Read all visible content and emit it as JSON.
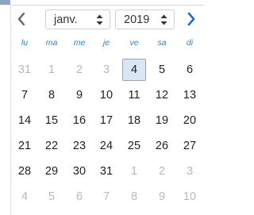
{
  "datepicker": {
    "month_value": "janv.",
    "year_value": "2019",
    "prev_icon": "chevron-left-icon",
    "next_icon": "chevron-right-icon",
    "select_arrows_icon": "updown-arrows-icon",
    "weekdays": [
      "lu",
      "ma",
      "me",
      "je",
      "ve",
      "sa",
      "di"
    ],
    "weeks": [
      [
        {
          "label": "31",
          "in_month": false
        },
        {
          "label": "1",
          "in_month": false
        },
        {
          "label": "2",
          "in_month": false
        },
        {
          "label": "3",
          "in_month": false
        },
        {
          "label": "4",
          "in_month": true,
          "selected": true
        },
        {
          "label": "5",
          "in_month": true
        },
        {
          "label": "6",
          "in_month": true
        }
      ],
      [
        {
          "label": "7",
          "in_month": true
        },
        {
          "label": "8",
          "in_month": true
        },
        {
          "label": "9",
          "in_month": true
        },
        {
          "label": "10",
          "in_month": true
        },
        {
          "label": "11",
          "in_month": true
        },
        {
          "label": "12",
          "in_month": true
        },
        {
          "label": "13",
          "in_month": true
        }
      ],
      [
        {
          "label": "14",
          "in_month": true
        },
        {
          "label": "15",
          "in_month": true
        },
        {
          "label": "16",
          "in_month": true
        },
        {
          "label": "17",
          "in_month": true
        },
        {
          "label": "18",
          "in_month": true
        },
        {
          "label": "19",
          "in_month": true
        },
        {
          "label": "20",
          "in_month": true
        }
      ],
      [
        {
          "label": "21",
          "in_month": true
        },
        {
          "label": "22",
          "in_month": true
        },
        {
          "label": "23",
          "in_month": true
        },
        {
          "label": "24",
          "in_month": true
        },
        {
          "label": "25",
          "in_month": true
        },
        {
          "label": "26",
          "in_month": true
        },
        {
          "label": "27",
          "in_month": true
        }
      ],
      [
        {
          "label": "28",
          "in_month": true
        },
        {
          "label": "29",
          "in_month": true
        },
        {
          "label": "30",
          "in_month": true
        },
        {
          "label": "31",
          "in_month": true
        },
        {
          "label": "1",
          "in_month": false
        },
        {
          "label": "2",
          "in_month": false
        },
        {
          "label": "3",
          "in_month": false
        }
      ],
      [
        {
          "label": "4",
          "in_month": false
        },
        {
          "label": "5",
          "in_month": false
        },
        {
          "label": "6",
          "in_month": false
        },
        {
          "label": "7",
          "in_month": false
        },
        {
          "label": "8",
          "in_month": false
        },
        {
          "label": "9",
          "in_month": false
        },
        {
          "label": "10",
          "in_month": false
        }
      ]
    ],
    "colors": {
      "weekday_label": "#2f7fd1",
      "next_arrow": "#1a73c8",
      "prev_arrow": "#666666",
      "muted_day": "#b9b9b9",
      "selected_bg": "#d9e6f4",
      "selected_border": "#9aa6b3"
    }
  }
}
